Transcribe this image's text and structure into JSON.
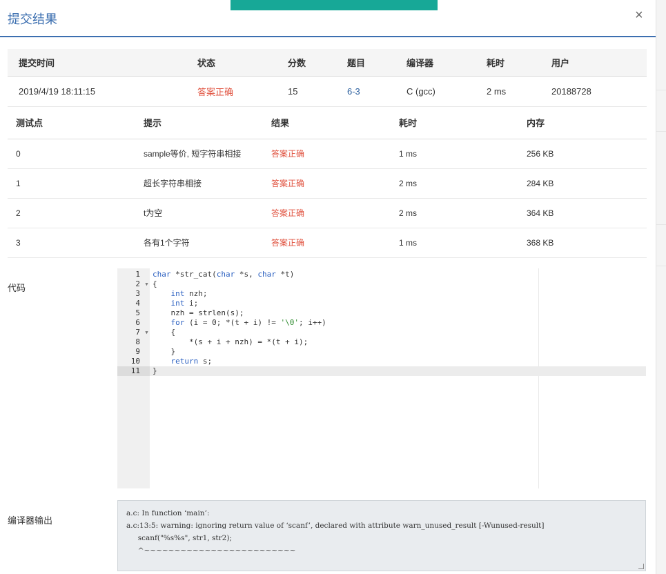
{
  "dialog": {
    "title": "提交结果",
    "close": "×"
  },
  "summary": {
    "headers": [
      "提交时间",
      "状态",
      "分数",
      "题目",
      "编译器",
      "耗时",
      "用户"
    ],
    "row": {
      "time": "2019/4/19 18:11:15",
      "status": "答案正确",
      "score": "15",
      "problem": "6-3",
      "compiler": "C (gcc)",
      "elapsed": "2 ms",
      "user": "20188728"
    }
  },
  "tests": {
    "headers": [
      "测试点",
      "提示",
      "结果",
      "耗时",
      "内存"
    ],
    "rows": [
      {
        "id": "0",
        "hint": "sample等价, 短字符串相接",
        "result": "答案正确",
        "time": "1 ms",
        "memory": "256 KB"
      },
      {
        "id": "1",
        "hint": "超长字符串相接",
        "result": "答案正确",
        "time": "2 ms",
        "memory": "284 KB"
      },
      {
        "id": "2",
        "hint": "t为空",
        "result": "答案正确",
        "time": "2 ms",
        "memory": "364 KB"
      },
      {
        "id": "3",
        "hint": "各有1个字符",
        "result": "答案正确",
        "time": "1 ms",
        "memory": "368 KB"
      }
    ]
  },
  "code": {
    "label": "代码",
    "lines": [
      "char *str_cat(char *s, char *t)",
      "{",
      "    int nzh;",
      "    int i;",
      "    nzh = strlen(s);",
      "    for (i = 0; *(t + i) != '\\0'; i++)",
      "    {",
      "        *(s + i + nzh) = *(t + i);",
      "    }",
      "    return s;",
      "}"
    ],
    "folds": [
      2,
      7
    ],
    "active_line": 11
  },
  "compiler_output": {
    "label": "编译器输出",
    "lines": [
      "a.c: In function ‘main’:",
      "a.c:13:5: warning: ignoring return value of ‘scanf’, declared with attribute warn_unused_result [-Wunused-result]",
      "     scanf(\"%s%s\", str1, str2);",
      "     ^~~~~~~~~~~~~~~~~~~~~~~~~~"
    ]
  },
  "icons": {
    "close": "close-icon",
    "fold": "fold-arrow-icon"
  },
  "colors": {
    "title": "#3c6fb0",
    "accepted": "#e0523f",
    "link": "#2b5f9e",
    "toast": "#17a897"
  }
}
